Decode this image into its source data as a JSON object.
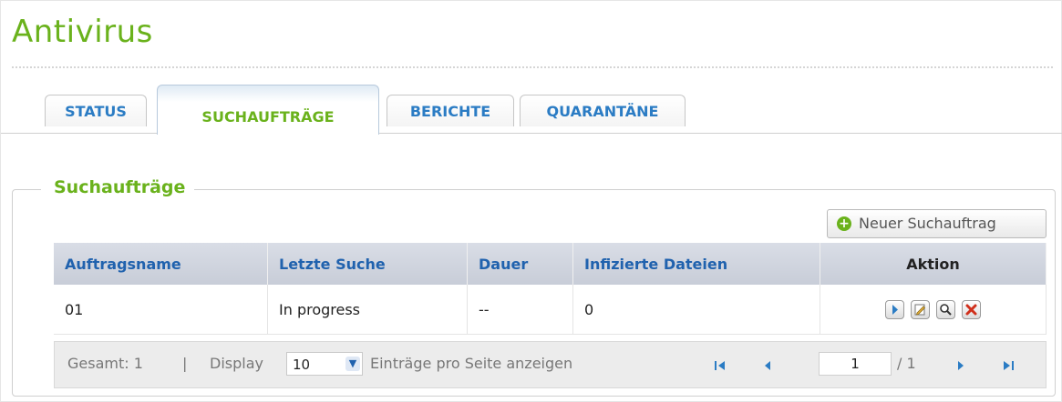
{
  "page": {
    "title": "Antivirus"
  },
  "tabs": [
    {
      "label": "STATUS",
      "active": false
    },
    {
      "label": "SUCHAUFTRÄGE",
      "active": true
    },
    {
      "label": "BERICHTE",
      "active": false
    },
    {
      "label": "QUARANTÄNE",
      "active": false
    }
  ],
  "section": {
    "legend": "Suchaufträge"
  },
  "toolbar": {
    "new_label": "Neuer Suchauftrag"
  },
  "table": {
    "columns": [
      "Auftragsname",
      "Letzte Suche",
      "Dauer",
      "Infizierte Dateien",
      "Aktion"
    ],
    "rows": [
      {
        "name": "01",
        "last_scan": "In progress",
        "duration": "--",
        "infected": "0",
        "actions": [
          "play-icon",
          "edit-icon",
          "view-icon",
          "delete-icon"
        ]
      }
    ]
  },
  "footer": {
    "total": "Gesamt: 1",
    "separator": "|",
    "display": "Display",
    "per_page": "10",
    "per_page_text": "Einträge pro Seite anzeigen",
    "page_current": "1",
    "page_total": "/ 1"
  },
  "colors": {
    "accent_green": "#6ab21c",
    "link_blue": "#2b7cc4",
    "header_blue": "#2062ae"
  }
}
